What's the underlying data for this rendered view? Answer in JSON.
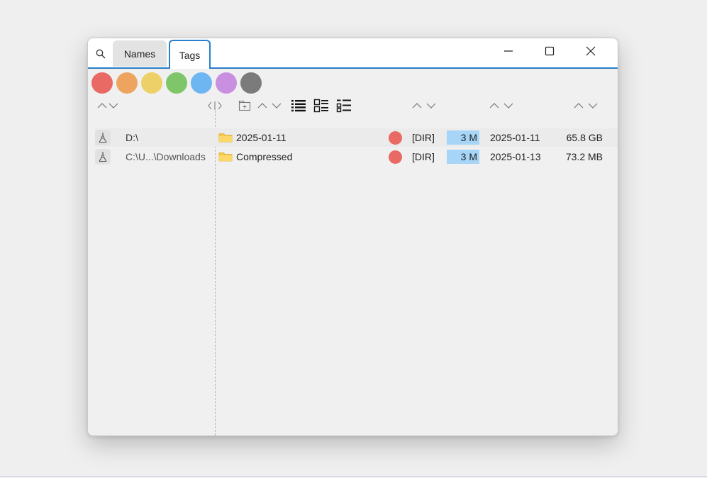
{
  "tabs": [
    {
      "label": "Names"
    },
    {
      "label": "Tags",
      "active": true
    }
  ],
  "colors": {
    "accent": "#2a7fc9",
    "tag_palette": [
      "#e96a64",
      "#eda45e",
      "#edd068",
      "#7fc56a",
      "#6db6f2",
      "#c98fe0",
      "#7b7b7b"
    ],
    "count_bar": "#a6d5f7"
  },
  "icons": {
    "search": "search-icon",
    "minimize": "minimize-icon",
    "maximize": "maximize-icon",
    "close": "close-icon",
    "drive": "drive-icon",
    "folder": "folder-icon",
    "new_folder": "new-folder-icon",
    "list_view": "list-view-icon",
    "detail_view": "detail-view-icon",
    "checklist_view": "checklist-view-icon",
    "split": "split-handle-icon"
  },
  "rows": [
    {
      "location": "D:\\",
      "name": "2025-01-11",
      "tag_color": "#e96a64",
      "type": "[DIR]",
      "count": "3 M",
      "date": "2025-01-11",
      "size": "65.8 GB"
    },
    {
      "location": "C:\\U...\\Downloads",
      "name": "Compressed",
      "tag_color": "#e96a64",
      "type": "[DIR]",
      "count": "3 M",
      "date": "2025-01-13",
      "size": "73.2 MB"
    }
  ]
}
